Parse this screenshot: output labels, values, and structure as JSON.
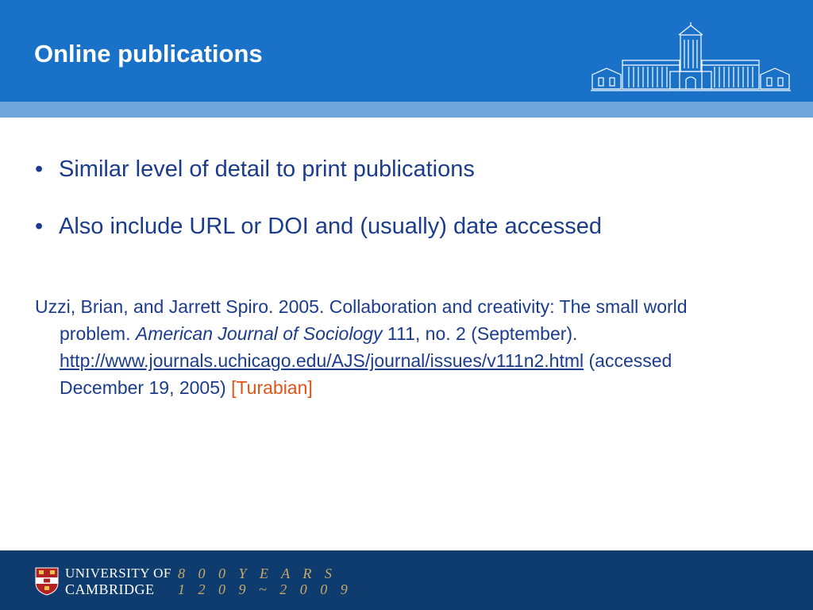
{
  "header": {
    "title": "Online publications",
    "colors": {
      "band": "#1a72c8",
      "stripe": "#6fa6dc"
    },
    "logo_icon": "university-building-icon"
  },
  "content": {
    "bullets": [
      "Similar level of detail to print publications",
      "Also include URL or DOI and (usually) date accessed"
    ],
    "reference": {
      "text_before": "Uzzi, Brian, and Jarrett Spiro. 2005. Collaboration and creativity: The small world problem. ",
      "journal": "American Journal of Sociology",
      "text_after": " 111, no. 2 (September). ",
      "url": "http://www.journals.uchicago.edu/AJS/journal/issues/v111n2.html",
      "accessed": " (accessed December 19, 2005) ",
      "style_tag": "[Turabian]"
    },
    "colors": {
      "text": "#1b3c8c",
      "style_tag": "#e0541a"
    }
  },
  "footer": {
    "university_line1": "UNIVERSITY OF",
    "university_line2": "CAMBRIDGE",
    "years_line1": "8 0 0  Y E A R S",
    "years_line2": "1 2 0 9 ~ 2 0 0 9",
    "crest_icon": "cambridge-crest-icon",
    "colors": {
      "band": "#0f3c6e",
      "years": "#c9a86a"
    }
  }
}
